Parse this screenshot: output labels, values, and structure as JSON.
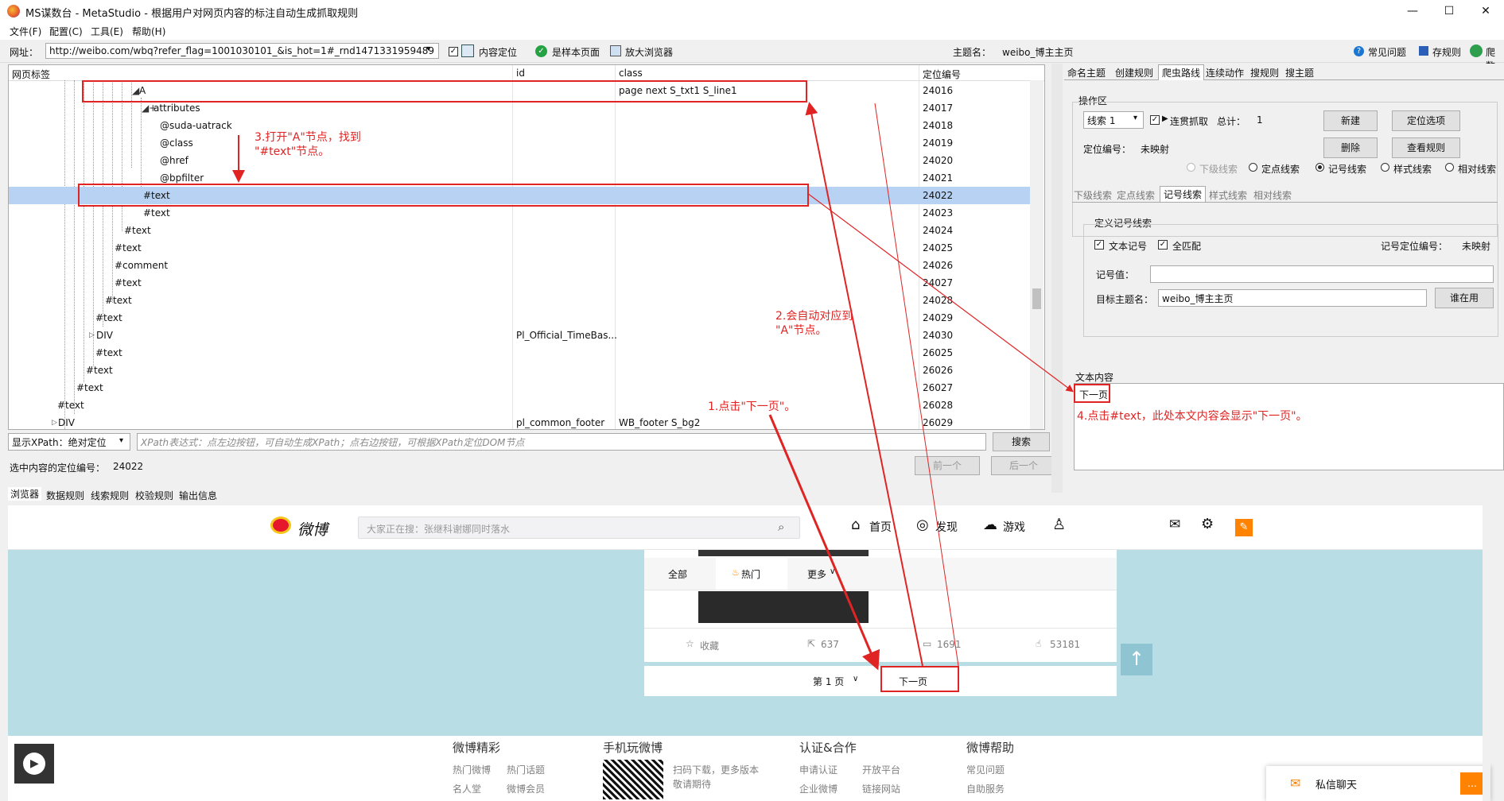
{
  "window": {
    "title": "MS谋数台 - MetaStudio - 根据用户对网页内容的标注自动生成抓取规则",
    "min": "—",
    "max": "☐",
    "close": "✕"
  },
  "menu": [
    "文件(F)",
    "配置(C)",
    "工具(E)",
    "帮助(H)"
  ],
  "address": {
    "label": "网址：",
    "url": "http://weibo.com/wbq?refer_flag=1001030101_&is_hot=1#_rnd1471331959489",
    "content_locate": "内容定位",
    "sample_page": "是样本页面",
    "enlarge_browser": "放大浏览器",
    "topic_label": "主题名：",
    "topic_value": "weibo_博主主页",
    "faq": "常见问题",
    "save_rule": "存规则",
    "crawl": "爬数"
  },
  "grid": {
    "headers": [
      "网页标签",
      "id",
      "class",
      "定位编号"
    ],
    "rows": [
      {
        "tag": "A",
        "id": "",
        "cls": "page next S_txt1 S_line1",
        "num": "24016"
      },
      {
        "tag": "attributes",
        "id": "",
        "cls": "",
        "num": "24017"
      },
      {
        "tag": "@suda-uatrack",
        "id": "",
        "cls": "",
        "num": "24018"
      },
      {
        "tag": "@class",
        "id": "",
        "cls": "",
        "num": "24019"
      },
      {
        "tag": "@href",
        "id": "",
        "cls": "",
        "num": "24020"
      },
      {
        "tag": "@bpfilter",
        "id": "",
        "cls": "",
        "num": "24021"
      },
      {
        "tag": "#text",
        "id": "",
        "cls": "",
        "num": "24022"
      },
      {
        "tag": "#text",
        "id": "",
        "cls": "",
        "num": "24023"
      },
      {
        "tag": "#text",
        "id": "",
        "cls": "",
        "num": "24024"
      },
      {
        "tag": "#text",
        "id": "",
        "cls": "",
        "num": "24025"
      },
      {
        "tag": "#comment",
        "id": "",
        "cls": "",
        "num": "24026"
      },
      {
        "tag": "#text",
        "id": "",
        "cls": "",
        "num": "24027"
      },
      {
        "tag": "#text",
        "id": "",
        "cls": "",
        "num": "24028"
      },
      {
        "tag": "#text",
        "id": "",
        "cls": "",
        "num": "24029"
      },
      {
        "tag": "DIV",
        "id": "Pl_Official_TimeBas...",
        "cls": "",
        "num": "24030"
      },
      {
        "tag": "#text",
        "id": "",
        "cls": "",
        "num": "26025"
      },
      {
        "tag": "#text",
        "id": "",
        "cls": "",
        "num": "26026"
      },
      {
        "tag": "#text",
        "id": "",
        "cls": "",
        "num": "26027"
      },
      {
        "tag": "#text",
        "id": "",
        "cls": "",
        "num": "26028"
      },
      {
        "tag": "DIV",
        "id": "pl_common_footer",
        "cls": "WB_footer S_bg2",
        "num": "26029"
      }
    ]
  },
  "xpath": {
    "mode": "显示XPath：绝对定位",
    "placeholder": "XPath表达式：点左边按钮，可自动生成XPath；点右边按钮，可根据XPath定位DOM节点",
    "search": "搜索",
    "selected_label": "选中内容的定位编号：",
    "selected_value": "24022",
    "prev": "前一个",
    "next": "后一个"
  },
  "bottom_tabs": [
    "浏览器",
    "数据规则",
    "线索规则",
    "校验规则",
    "输出信息"
  ],
  "right": {
    "tabs": [
      "命名主题",
      "创建规则",
      "爬虫路线",
      "连续动作",
      "搜规则",
      "搜主题"
    ],
    "ops_title": "操作区",
    "line_select": "线索 1",
    "continuous": "连贯抓取",
    "total_label": "总计：",
    "total_value": "1",
    "new_btn": "新建",
    "locate_btn": "定位选项",
    "loc_label": "定位编号：",
    "loc_value": "未映射",
    "delete_btn": "删除",
    "view_btn": "查看规则",
    "radios": [
      "下级线索",
      "定点线索",
      "记号线索",
      "样式线索",
      "相对线索"
    ],
    "subtabs": [
      "下级线索",
      "定点线索",
      "记号线索",
      "样式线索",
      "相对线索"
    ],
    "define_title": "定义记号线索",
    "text_mark": "文本记号",
    "full_match": "全匹配",
    "mark_loc_label": "记号定位编号：",
    "mark_loc_value": "未映射",
    "mark_value_label": "记号值：",
    "mark_value": "",
    "target_label": "目标主题名：",
    "target_value": "weibo_博主主页",
    "in_use": "谁在用",
    "text_content_title": "文本内容",
    "text_content": "下一页"
  },
  "annotations": {
    "a1": "1.点击\"下一页\"。",
    "a2": "2.会自动对应到\n\"A\"节点。",
    "a3": "3.打开\"A\"节点，找到\n\"#text\"节点。",
    "a4": "4.点击#text，此处本文内容会显示\"下一页\"。"
  },
  "weibo": {
    "brand": "微博",
    "search_placeholder": "大家正在搜：张继科谢娜同时落水",
    "nav": [
      "首页",
      "发现",
      "游戏"
    ],
    "tabs": [
      "全部",
      "热门",
      "更多"
    ],
    "actions": [
      "收藏",
      "637",
      "1691",
      "53181"
    ],
    "page": "第 1 页",
    "next_page": "下一页",
    "footer": {
      "c1": {
        "title": "微博精彩",
        "links": [
          "热门微博",
          "热门话题",
          "名人堂",
          "微博会员"
        ]
      },
      "c2": {
        "title": "手机玩微博",
        "links": [
          "扫码下载，更多版本",
          "敬请期待"
        ]
      },
      "c3": {
        "title": "认证&合作",
        "links": [
          "申请认证",
          "开放平台",
          "企业微博",
          "链接网站"
        ]
      },
      "c4": {
        "title": "微博帮助",
        "links": [
          "常见问题",
          "自助服务"
        ]
      }
    },
    "chat": "私信聊天"
  }
}
